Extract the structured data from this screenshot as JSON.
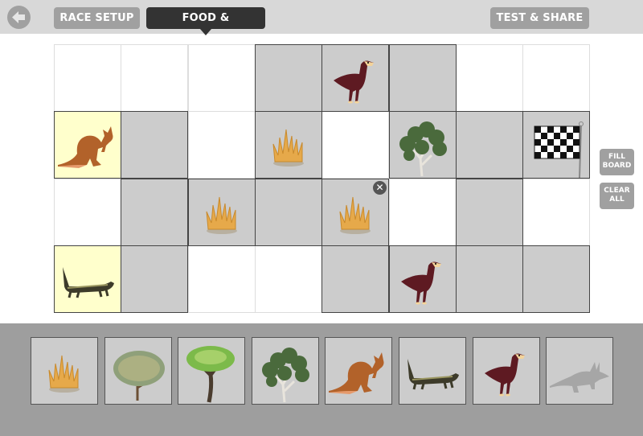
{
  "header": {
    "back_icon": "arrow-left-icon",
    "tabs": [
      {
        "label": "RACE SETUP",
        "active": false
      },
      {
        "label": "FOOD & PREDATORS",
        "active": true
      }
    ],
    "test_share_label": "TEST & SHARE"
  },
  "board": {
    "rows": 4,
    "cols": 8,
    "cells": [
      [
        {
          "shade": false,
          "item": null
        },
        {
          "shade": false,
          "item": null
        },
        {
          "shade": false,
          "item": null
        },
        {
          "shade": true,
          "item": null
        },
        {
          "shade": true,
          "item": "eagle"
        },
        {
          "shade": true,
          "item": null
        },
        {
          "shade": false,
          "item": null
        },
        {
          "shade": false,
          "item": null
        }
      ],
      [
        {
          "shade": false,
          "start": true,
          "item": "kangaroo"
        },
        {
          "shade": true,
          "item": null
        },
        {
          "shade": false,
          "item": null
        },
        {
          "shade": true,
          "item": "grass"
        },
        {
          "shade": false,
          "item": null
        },
        {
          "shade": true,
          "item": "gum-tree"
        },
        {
          "shade": true,
          "item": null
        },
        {
          "shade": true,
          "item": "finish-flag"
        }
      ],
      [
        {
          "shade": false,
          "item": null
        },
        {
          "shade": true,
          "item": null
        },
        {
          "shade": true,
          "item": "grass"
        },
        {
          "shade": true,
          "item": null
        },
        {
          "shade": true,
          "item": "grass",
          "removable": true
        },
        {
          "shade": false,
          "item": null
        },
        {
          "shade": true,
          "item": null
        },
        {
          "shade": false,
          "item": null
        }
      ],
      [
        {
          "shade": false,
          "start": true,
          "item": "thorny-devil"
        },
        {
          "shade": true,
          "item": null
        },
        {
          "shade": false,
          "item": null
        },
        {
          "shade": false,
          "item": null
        },
        {
          "shade": true,
          "item": null
        },
        {
          "shade": true,
          "item": "eagle"
        },
        {
          "shade": true,
          "item": null
        },
        {
          "shade": true,
          "item": null
        }
      ]
    ],
    "remove_icon": "close-circle-icon"
  },
  "side_buttons": {
    "fill_line1": "FILL",
    "fill_line2": "BOARD",
    "clear_line1": "CLEAR",
    "clear_line2": "ALL"
  },
  "tray": {
    "items": [
      "grass",
      "acacia-tree",
      "green-tree",
      "gum-tree",
      "kangaroo",
      "thorny-devil",
      "eagle",
      "bilby"
    ]
  },
  "colors": {
    "topbar": "#d8d8d8",
    "tab_inactive": "#a0a0a0",
    "tab_active": "#333333",
    "shaded_cell": "#cccccc",
    "start_cell": "#ffffcc",
    "tray": "#9e9e9e"
  }
}
